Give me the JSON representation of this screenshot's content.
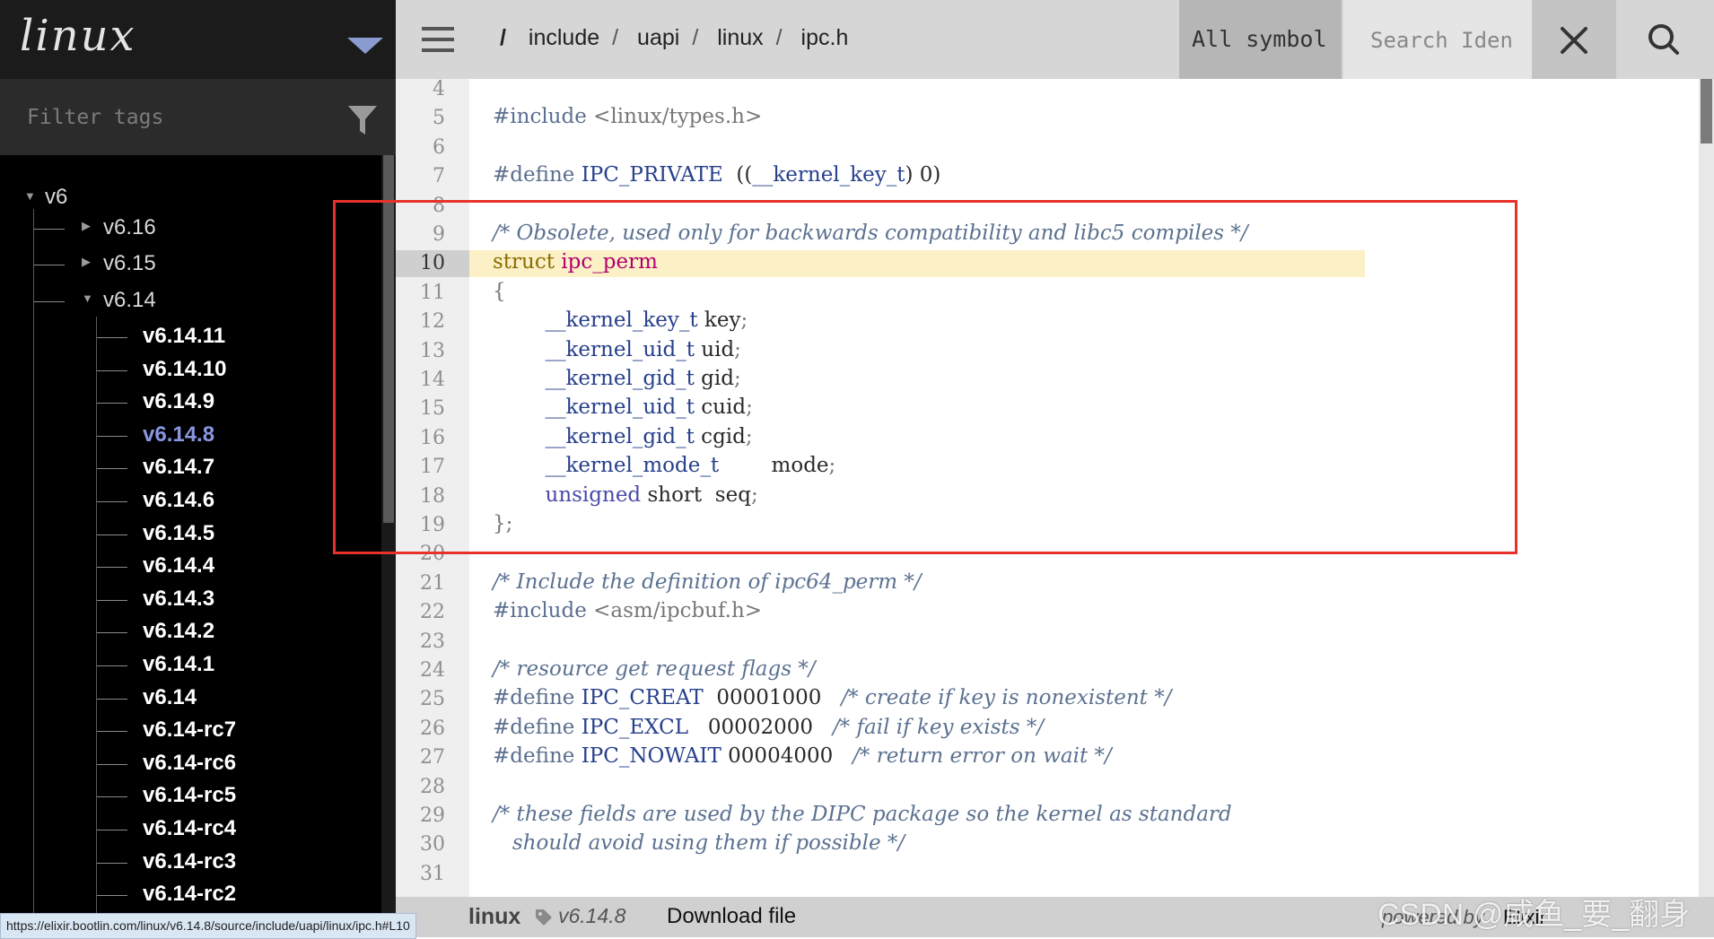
{
  "project": {
    "name": "linux"
  },
  "filter": {
    "placeholder": "Filter tags"
  },
  "tree": {
    "root": "v6",
    "branches": [
      "v6.16",
      "v6.15",
      "v6.14"
    ],
    "versions": [
      "v6.14.11",
      "v6.14.10",
      "v6.14.9",
      "v6.14.8",
      "v6.14.7",
      "v6.14.6",
      "v6.14.5",
      "v6.14.4",
      "v6.14.3",
      "v6.14.2",
      "v6.14.1",
      "v6.14",
      "v6.14-rc7",
      "v6.14-rc6",
      "v6.14-rc5",
      "v6.14-rc4",
      "v6.14-rc3",
      "v6.14-rc2"
    ],
    "active": "v6.14.8"
  },
  "breadcrumb": {
    "root": "/",
    "parts": [
      "include",
      "uapi",
      "linux",
      "ipc.h"
    ]
  },
  "search": {
    "type_label": "All symbol",
    "placeholder": "Search Iden"
  },
  "code": {
    "highlight_line": 10,
    "lines": [
      {
        "n": "4",
        "t": []
      },
      {
        "n": "5",
        "t": [
          [
            "pp",
            "#include "
          ],
          [
            "br",
            "<linux/types.h>"
          ]
        ]
      },
      {
        "n": "6",
        "t": []
      },
      {
        "n": "7",
        "t": [
          [
            "pp",
            "#define "
          ],
          [
            "id",
            "IPC_PRIVATE"
          ],
          [
            "",
            "  (("
          ],
          [
            "id",
            "__kernel_key_t"
          ],
          [
            "",
            ") 0)"
          ]
        ]
      },
      {
        "n": "8",
        "t": []
      },
      {
        "n": "9",
        "t": [
          [
            "cm",
            "/* Obsolete, used only for backwards compatibility and libc5 compiles */"
          ]
        ]
      },
      {
        "n": "10",
        "t": [
          [
            "kw",
            "struct "
          ],
          [
            "idm",
            "ipc_perm"
          ]
        ]
      },
      {
        "n": "11",
        "t": [
          [
            "br",
            "{"
          ]
        ]
      },
      {
        "n": "12",
        "t": [
          [
            "",
            "        "
          ],
          [
            "id",
            "__kernel_key_t"
          ],
          [
            "",
            " key"
          ],
          [
            "br",
            ";"
          ]
        ]
      },
      {
        "n": "13",
        "t": [
          [
            "",
            "        "
          ],
          [
            "id",
            "__kernel_uid_t"
          ],
          [
            "",
            " uid"
          ],
          [
            "br",
            ";"
          ]
        ]
      },
      {
        "n": "14",
        "t": [
          [
            "",
            "        "
          ],
          [
            "id",
            "__kernel_gid_t"
          ],
          [
            "",
            " gid"
          ],
          [
            "br",
            ";"
          ]
        ]
      },
      {
        "n": "15",
        "t": [
          [
            "",
            "        "
          ],
          [
            "id",
            "__kernel_uid_t"
          ],
          [
            "",
            " cuid"
          ],
          [
            "br",
            ";"
          ]
        ]
      },
      {
        "n": "16",
        "t": [
          [
            "",
            "        "
          ],
          [
            "id",
            "__kernel_gid_t"
          ],
          [
            "",
            " cgid"
          ],
          [
            "br",
            ";"
          ]
        ]
      },
      {
        "n": "17",
        "t": [
          [
            "",
            "        "
          ],
          [
            "id",
            "__kernel_mode_t"
          ],
          [
            "",
            "        mode"
          ],
          [
            "br",
            ";"
          ]
        ]
      },
      {
        "n": "18",
        "t": [
          [
            "",
            "        "
          ],
          [
            "tp",
            "unsigned"
          ],
          [
            "",
            " short  seq"
          ],
          [
            "br",
            ";"
          ]
        ]
      },
      {
        "n": "19",
        "t": [
          [
            "br",
            "};"
          ]
        ]
      },
      {
        "n": "20",
        "t": []
      },
      {
        "n": "21",
        "t": [
          [
            "cm",
            "/* Include the definition of ipc64_perm */"
          ]
        ]
      },
      {
        "n": "22",
        "t": [
          [
            "pp",
            "#include "
          ],
          [
            "br",
            "<asm/ipcbuf.h>"
          ]
        ]
      },
      {
        "n": "23",
        "t": []
      },
      {
        "n": "24",
        "t": [
          [
            "cm",
            "/* resource get request flags */"
          ]
        ]
      },
      {
        "n": "25",
        "t": [
          [
            "pp",
            "#define "
          ],
          [
            "id",
            "IPC_CREAT"
          ],
          [
            "",
            "  00001000   "
          ],
          [
            "cm",
            "/* create if key is nonexistent */"
          ]
        ]
      },
      {
        "n": "26",
        "t": [
          [
            "pp",
            "#define "
          ],
          [
            "id",
            "IPC_EXCL"
          ],
          [
            "",
            "   00002000   "
          ],
          [
            "cm",
            "/* fail if key exists */"
          ]
        ]
      },
      {
        "n": "27",
        "t": [
          [
            "pp",
            "#define "
          ],
          [
            "id",
            "IPC_NOWAIT"
          ],
          [
            "",
            " 00004000   "
          ],
          [
            "cm",
            "/* return error on wait */"
          ]
        ]
      },
      {
        "n": "28",
        "t": []
      },
      {
        "n": "29",
        "t": [
          [
            "cm",
            "/* these fields are used by the DIPC package so the kernel as standard"
          ]
        ]
      },
      {
        "n": "30",
        "t": [
          [
            "cm",
            "   should avoid using them if possible */"
          ]
        ]
      },
      {
        "n": "31",
        "t": []
      }
    ]
  },
  "footer": {
    "project": "linux",
    "version": "v6.14.8",
    "download_label": "Download file",
    "powered_by": "powered by",
    "engine": "Elixir"
  },
  "status_url": "https://elixir.bootlin.com/linux/v6.14.8/source/include/uapi/linux/ipc.h#L10",
  "watermark": "CSDN @咸鱼_要_翻身",
  "colors": {
    "accent": "#8a97e0",
    "highlight": "#fbf0c6",
    "annotation": "#e8312a"
  }
}
